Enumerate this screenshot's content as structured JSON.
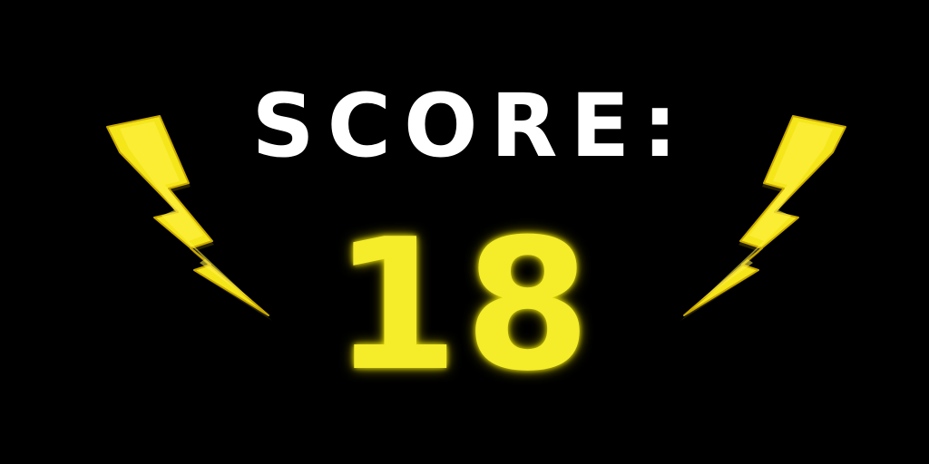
{
  "score": {
    "label": "SCORE:",
    "value": "18"
  },
  "icons": {
    "left": "lightning-bolt-icon",
    "right": "lightning-bolt-icon"
  },
  "colors": {
    "background": "#000000",
    "label": "#ffffff",
    "value": "#f5ec2a",
    "bolt_fill": "#f5e61a",
    "bolt_shade": "#e3c200"
  }
}
